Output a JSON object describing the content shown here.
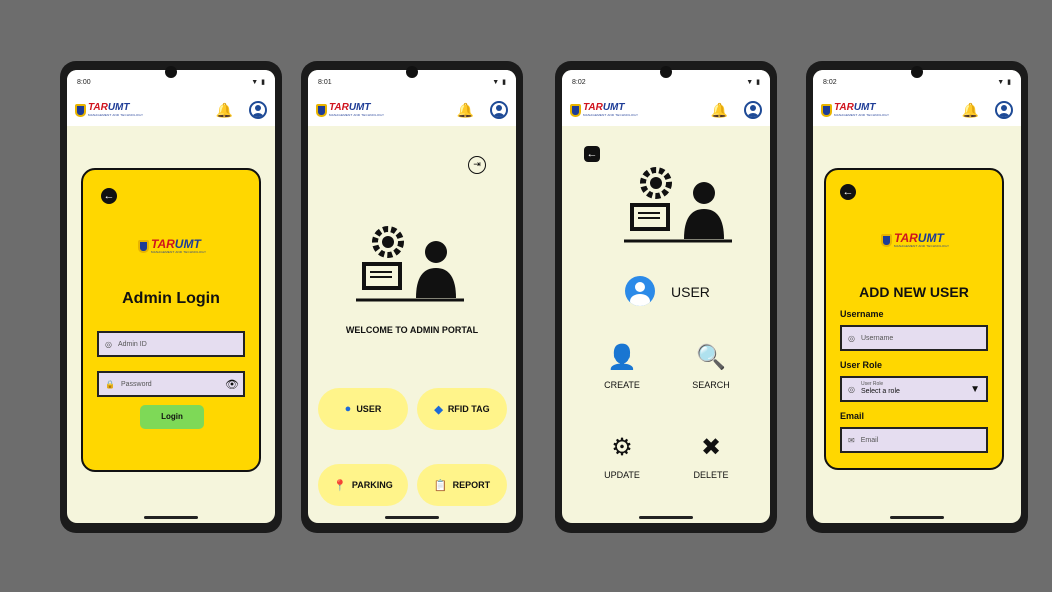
{
  "brand": {
    "logo_a": "TAR",
    "logo_b": "UMT",
    "logo_sub": "MANAGEMENT AND TECHNOLOGY"
  },
  "screens": [
    {
      "time": "8:00"
    },
    {
      "time": "8:01"
    },
    {
      "time": "8:02"
    },
    {
      "time": "8:02"
    }
  ],
  "login": {
    "title": "Admin Login",
    "admin_id_placeholder": "Admin ID",
    "password_placeholder": "Password",
    "login_label": "Login"
  },
  "portal": {
    "welcome": "WELCOME TO ADMIN PORTAL",
    "buttons": [
      {
        "label": "USER",
        "icon": "user-icon"
      },
      {
        "label": "RFID TAG",
        "icon": "rfid-tag-icon"
      },
      {
        "label": "PARKING",
        "icon": "parking-pin-icon"
      },
      {
        "label": "REPORT",
        "icon": "report-icon"
      }
    ]
  },
  "user_menu": {
    "heading": "USER",
    "options": [
      {
        "label": "CREATE",
        "icon": "create-user-icon"
      },
      {
        "label": "SEARCH",
        "icon": "search-user-icon"
      },
      {
        "label": "UPDATE",
        "icon": "update-user-icon"
      },
      {
        "label": "DELETE",
        "icon": "delete-user-icon"
      }
    ]
  },
  "add_user": {
    "title": "ADD NEW USER",
    "username_label": "Username",
    "username_placeholder": "Username",
    "role_label": "User Role",
    "role_field_label": "User Role",
    "role_value": "Select a role",
    "email_label": "Email",
    "email_placeholder": "Email"
  },
  "colors": {
    "accent_yellow": "#ffd700",
    "login_green": "#7ed957",
    "pill_yellow": "#fff48a",
    "background": "#6d6d6d"
  }
}
